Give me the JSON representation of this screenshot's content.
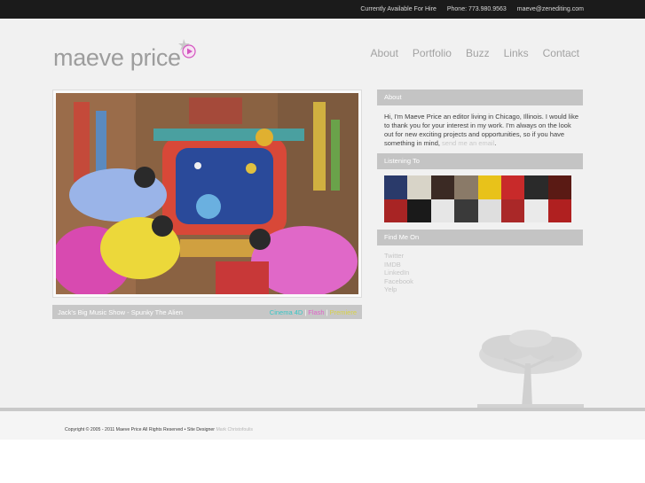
{
  "topbar": {
    "availability": "Currently Available For Hire",
    "phone": "Phone: 773.980.9563",
    "email": "maeve@zenediting.com"
  },
  "logo": {
    "text": "maeve price"
  },
  "nav": [
    "About",
    "Portfolio",
    "Buzz",
    "Links",
    "Contact"
  ],
  "video": {
    "caption": "Jack's Big Music Show - Spunky The Alien",
    "tags": [
      "Cinema 4D",
      "Flash",
      "Premiere"
    ],
    "separator": "|"
  },
  "sidebar": {
    "about": {
      "heading": "About",
      "text": "Hi, I'm Maeve Price an editor living in Chicago, Illinois. I would like to thank you for your interest in my work. I'm always on the look out for new exciting projects and opportunities, so if you have something in mind,",
      "link": "send me an email",
      "end": "."
    },
    "listening": {
      "heading": "Listening To",
      "albums": [
        "#2a3a6a",
        "#d8d4c8",
        "#3b2a24",
        "#8a7a68",
        "#e8c21a",
        "#c82a2a",
        "#2a2a2a",
        "#5a1a14",
        "#a82424",
        "#1a1a1a",
        "#e6e6e6",
        "#3a3a3a",
        "#dedede",
        "#aa2828",
        "#eaeaea",
        "#b02020"
      ]
    },
    "find": {
      "heading": "Find Me On",
      "links": [
        "Twitter",
        "IMDB",
        "LinkedIn",
        "Facebook",
        "Yelp"
      ]
    }
  },
  "footer": {
    "copyright": "Copyright © 2005 - 2011 Maeve Price All Rights Reserved • Site Designer",
    "designer": "Mark Christofoulis"
  },
  "colors": {
    "accent_pink": "#e064c8",
    "accent_cyan": "#37c6c6",
    "accent_yellow": "#d8d248"
  }
}
